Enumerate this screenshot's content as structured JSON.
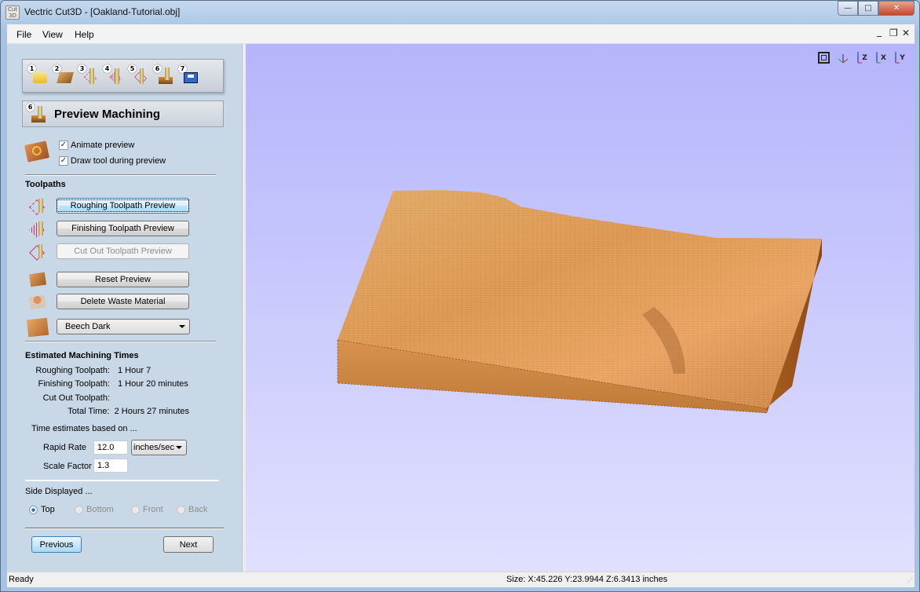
{
  "window": {
    "title": "Vectric Cut3D - [Oakland-Tutorial.obj]",
    "app_icon_text": "Cut 3D"
  },
  "caption_buttons": {
    "minimize": "—",
    "maximize": "□",
    "close": "✕"
  },
  "menu": {
    "items": [
      "File",
      "View",
      "Help"
    ],
    "mdi_minimize": "_",
    "mdi_restore": "❐",
    "mdi_close": "✕"
  },
  "toolbar": {
    "steps": [
      {
        "num": "1",
        "icon": "open-folder"
      },
      {
        "num": "2",
        "icon": "material-block"
      },
      {
        "num": "3",
        "icon": "roughing-toolpath"
      },
      {
        "num": "4",
        "icon": "finishing-toolpath"
      },
      {
        "num": "5",
        "icon": "cutout-toolpath"
      },
      {
        "num": "6",
        "icon": "preview-machining"
      },
      {
        "num": "7",
        "icon": "save-toolpath"
      }
    ]
  },
  "header": {
    "num": "6",
    "title": "Preview Machining"
  },
  "options": {
    "animate_preview": "Animate preview",
    "animate_checked": true,
    "draw_tool": "Draw tool during preview",
    "draw_tool_checked": true
  },
  "toolpaths": {
    "heading": "Toolpaths",
    "roughing": "Roughing Toolpath Preview",
    "finishing": "Finishing Toolpath Preview",
    "cutout": "Cut Out Toolpath Preview"
  },
  "actions": {
    "reset": "Reset Preview",
    "delete_waste": "Delete Waste Material"
  },
  "material": {
    "selected": "Beech Dark"
  },
  "times": {
    "heading": "Estimated Machining Times",
    "rows": [
      {
        "label": "Roughing Toolpath:",
        "value": "1 Hour 7"
      },
      {
        "label": "Finishing Toolpath:",
        "value": "1 Hour 20 minutes"
      },
      {
        "label": "Cut Out Toolpath:",
        "value": ""
      },
      {
        "label": "Total Time:",
        "value": "2 Hours 27 minutes"
      }
    ],
    "based_on": "Time estimates based on ...",
    "rapid_rate_label": "Rapid Rate",
    "rapid_rate_value": "12.0",
    "rapid_rate_unit": "inches/sec",
    "scale_factor_label": "Scale Factor",
    "scale_factor_value": "1.3"
  },
  "side": {
    "heading": "Side Displayed ...",
    "options": [
      {
        "label": "Top",
        "selected": true,
        "enabled": true
      },
      {
        "label": "Bottom",
        "selected": false,
        "enabled": false
      },
      {
        "label": "Front",
        "selected": false,
        "enabled": false
      },
      {
        "label": "Back",
        "selected": false,
        "enabled": false
      }
    ]
  },
  "nav": {
    "previous": "Previous",
    "next": "Next"
  },
  "view_tools": [
    "fit-view",
    "iso-view",
    "top-view-z",
    "front-view-x",
    "side-view-y"
  ],
  "view_tool_labels": [
    "",
    "",
    "Z",
    "X",
    "Y"
  ],
  "status": {
    "left": "Ready",
    "size": "Size: X:45.226 Y:23.9944 Z:6.3413 inches"
  },
  "colors": {
    "viewport_top": "#b5b5fc",
    "viewport_bottom": "#e0e0fe",
    "panel": "#c9d8e6",
    "wood": "#d08a40"
  }
}
